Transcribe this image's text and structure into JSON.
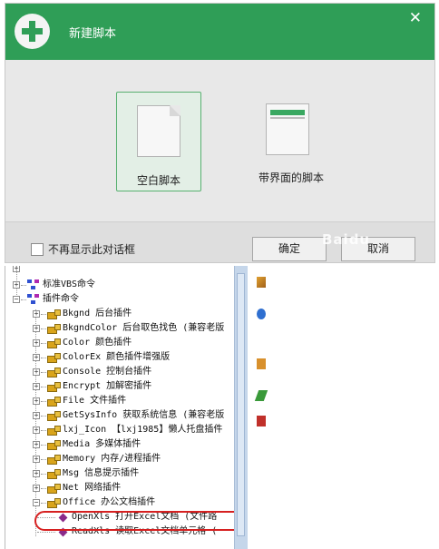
{
  "dialog": {
    "title": "新建脚本",
    "close_glyph": "✕",
    "options": [
      {
        "label": "空白脚本",
        "selected": true
      },
      {
        "label": "带界面的脚本",
        "selected": false
      }
    ],
    "checkbox_label": "不再显示此对话框",
    "ok_label": "确定",
    "cancel_label": "取消",
    "watermark": "Baidu"
  },
  "tree": {
    "partial_top": "",
    "rows": [
      {
        "label": "标准VBS命令",
        "level": 0,
        "expander": "+",
        "icon": "command-icon"
      },
      {
        "label": "插件命令",
        "level": 0,
        "expander": "-",
        "icon": "command-icon"
      },
      {
        "label": "Bkgnd 后台插件",
        "level": 1,
        "expander": "+",
        "icon": "plugin-icon"
      },
      {
        "label": "BkgndColor 后台取色找色 (兼容老版",
        "level": 1,
        "expander": "+",
        "icon": "plugin-icon"
      },
      {
        "label": "Color 颜色插件",
        "level": 1,
        "expander": "+",
        "icon": "plugin-icon"
      },
      {
        "label": "ColorEx 颜色插件增强版",
        "level": 1,
        "expander": "+",
        "icon": "plugin-icon"
      },
      {
        "label": "Console 控制台插件",
        "level": 1,
        "expander": "+",
        "icon": "plugin-icon"
      },
      {
        "label": "Encrypt 加解密插件",
        "level": 1,
        "expander": "+",
        "icon": "plugin-icon"
      },
      {
        "label": "File 文件插件",
        "level": 1,
        "expander": "+",
        "icon": "plugin-icon"
      },
      {
        "label": "GetSysInfo 获取系统信息 (兼容老版",
        "level": 1,
        "expander": "+",
        "icon": "plugin-icon"
      },
      {
        "label": "lxj_Icon 【lxj1985】懒人托盘插件",
        "level": 1,
        "expander": "+",
        "icon": "plugin-icon"
      },
      {
        "label": "Media 多媒体插件",
        "level": 1,
        "expander": "+",
        "icon": "plugin-icon"
      },
      {
        "label": "Memory 内存/进程插件",
        "level": 1,
        "expander": "+",
        "icon": "plugin-icon"
      },
      {
        "label": "Msg 信息提示插件",
        "level": 1,
        "expander": "+",
        "icon": "plugin-icon"
      },
      {
        "label": "Net 网络插件",
        "level": 1,
        "expander": "+",
        "icon": "plugin-icon"
      },
      {
        "label": "Office 办公文档插件",
        "level": 1,
        "expander": "-",
        "icon": "plugin-icon"
      },
      {
        "label": "OpenXls 打开Excel文档 (文件路",
        "level": 2,
        "expander": "",
        "icon": "function-icon",
        "highlighted": true
      },
      {
        "label": "ReadXls 读取Excel文档单元格 (",
        "level": 2,
        "expander": "",
        "icon": "function-icon"
      }
    ]
  },
  "colors": {
    "header_green": "#2f9e57",
    "highlight_red": "#d62020"
  }
}
